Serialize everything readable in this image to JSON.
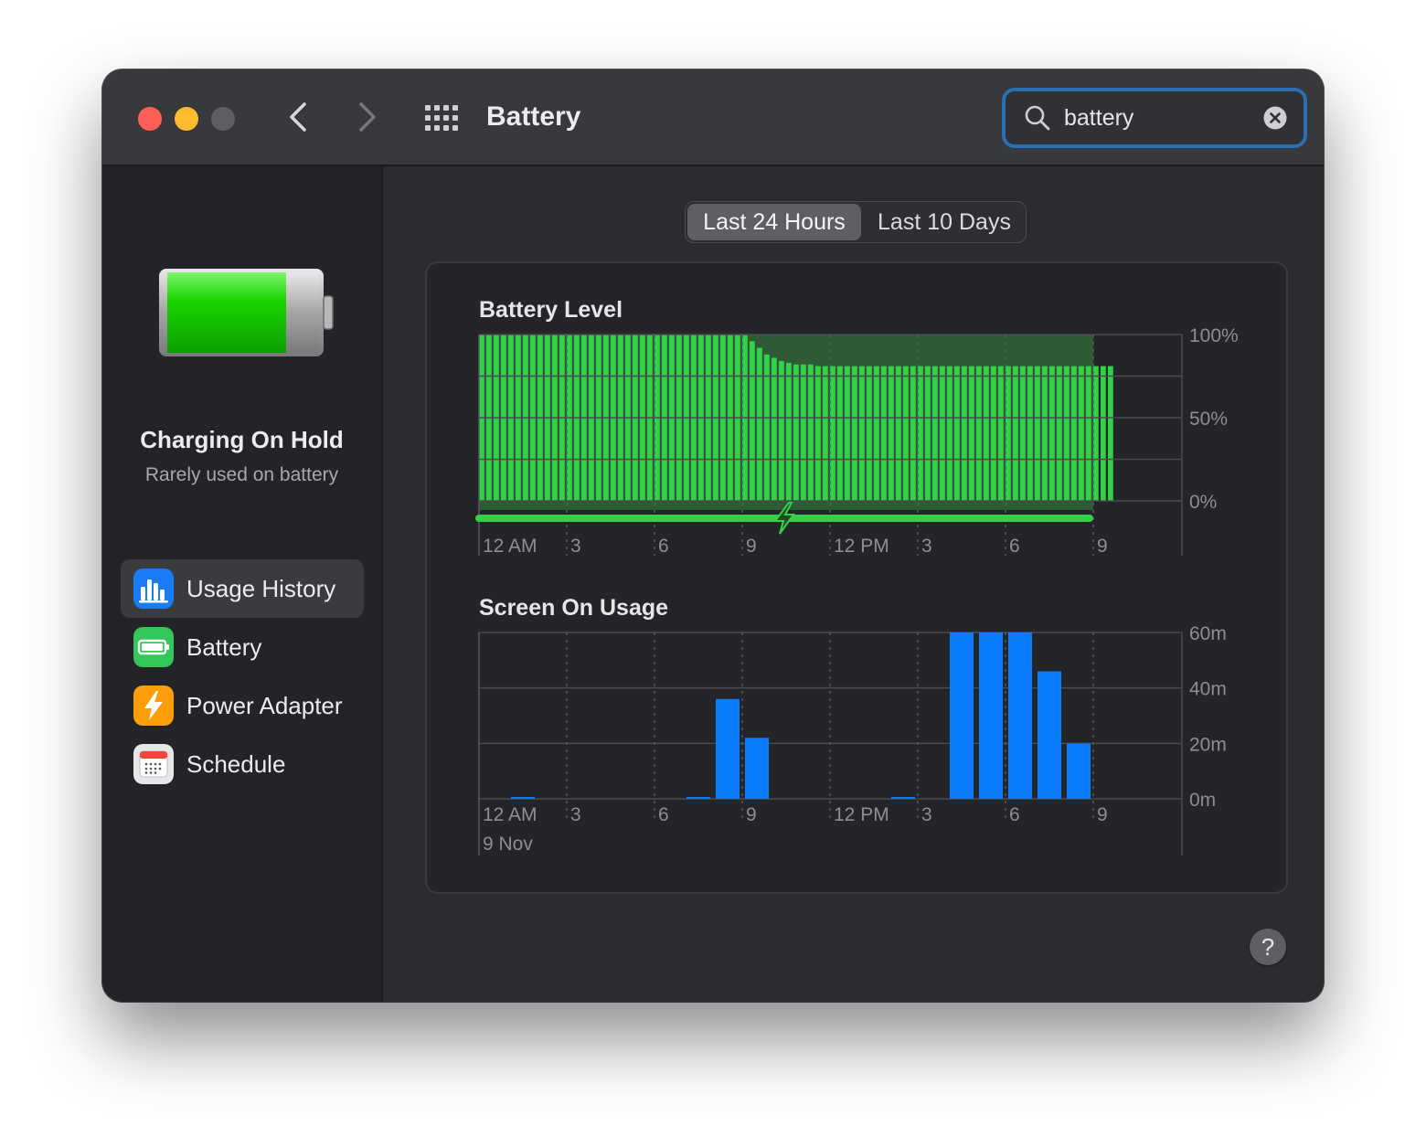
{
  "window": {
    "title": "Battery"
  },
  "search": {
    "value": "battery"
  },
  "sidebar": {
    "status_title": "Charging On Hold",
    "status_subtitle": "Rarely used on battery",
    "items": [
      {
        "label": "Usage History",
        "icon": "bar-chart-icon",
        "selected": true
      },
      {
        "label": "Battery",
        "icon": "battery-icon",
        "selected": false
      },
      {
        "label": "Power Adapter",
        "icon": "lightning-icon",
        "selected": false
      },
      {
        "label": "Schedule",
        "icon": "calendar-icon",
        "selected": false
      }
    ]
  },
  "range_tabs": [
    {
      "label": "Last 24 Hours",
      "active": true
    },
    {
      "label": "Last 10 Days",
      "active": false
    }
  ],
  "colors": {
    "battery_green": "#33d14a",
    "usage_blue": "#0a7cfc",
    "search_focus": "#2a6fb1"
  },
  "help_label": "?",
  "chart_data": [
    {
      "type": "bar",
      "title": "Battery Level",
      "x_ticks": [
        "12 AM",
        "3",
        "6",
        "9",
        "12 PM",
        "3",
        "6",
        "9"
      ],
      "y_ticks": [
        "100%",
        "50%",
        "0%"
      ],
      "ylim": [
        0,
        100
      ],
      "interval_minutes": 15,
      "values": [
        100,
        100,
        100,
        100,
        100,
        100,
        100,
        100,
        100,
        100,
        100,
        100,
        100,
        100,
        100,
        100,
        100,
        100,
        100,
        100,
        100,
        100,
        100,
        100,
        100,
        100,
        100,
        100,
        100,
        100,
        100,
        100,
        100,
        100,
        100,
        100,
        100,
        96,
        92,
        88,
        86,
        84,
        83,
        82,
        82,
        82,
        81,
        81,
        81,
        81,
        81,
        81,
        81,
        81,
        81,
        81,
        81,
        81,
        81,
        81,
        81,
        81,
        81,
        81,
        81,
        81,
        81,
        81,
        81,
        81,
        81,
        81,
        81,
        81,
        81,
        81,
        81,
        81,
        81,
        81,
        81,
        81,
        81,
        81,
        81,
        81,
        81
      ],
      "charging_indicator": "plugged in through 9 PM",
      "charging_icon": "lightning-icon"
    },
    {
      "type": "bar",
      "title": "Screen On Usage",
      "x_ticks": [
        "12 AM",
        "3",
        "6",
        "9",
        "12 PM",
        "3",
        "6",
        "9"
      ],
      "date_label": "9 Nov",
      "y_ticks": [
        "60m",
        "40m",
        "20m",
        "0m"
      ],
      "ylim": [
        0,
        60
      ],
      "unit": "minutes",
      "hours": [
        0,
        1,
        2,
        3,
        4,
        5,
        6,
        7,
        8,
        9,
        10,
        11,
        12,
        13,
        14,
        15,
        16,
        17,
        18,
        19,
        20
      ],
      "values": [
        0,
        0.5,
        0,
        0,
        0,
        0,
        0,
        0.5,
        36,
        22,
        0,
        0,
        0,
        0,
        0.5,
        0,
        60,
        60,
        60,
        46,
        20
      ]
    }
  ]
}
